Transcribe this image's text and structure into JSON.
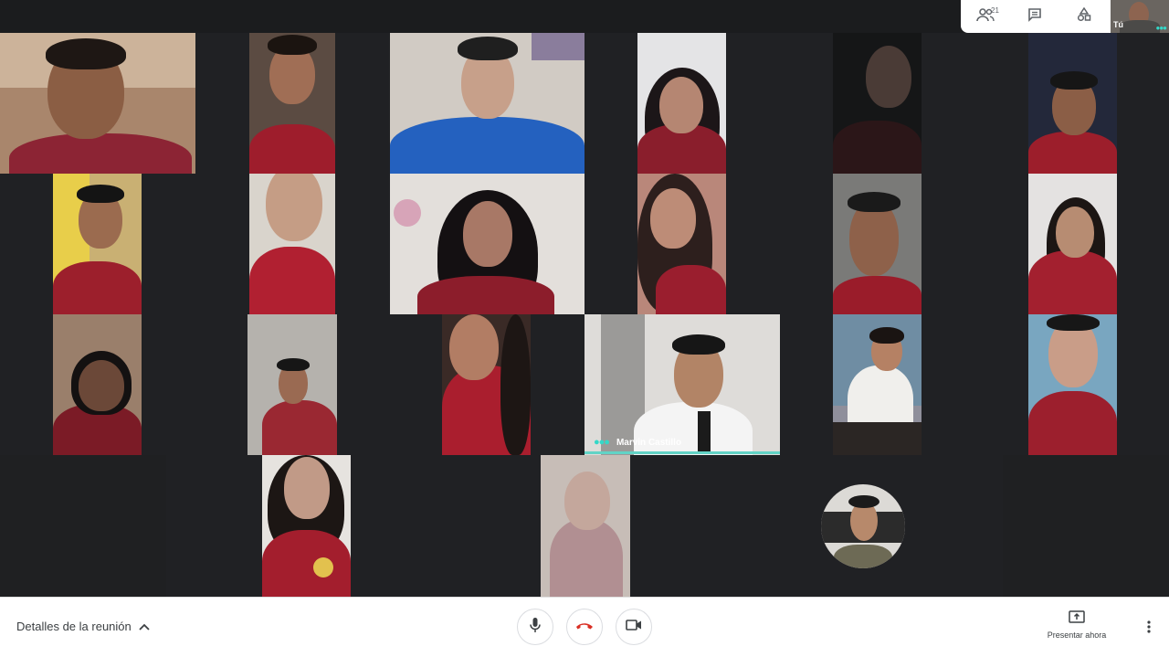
{
  "meeting": {
    "speaker_name": "Marvin Castillo",
    "self_label": "Tú",
    "participants_count": "21"
  },
  "toolbar": {
    "details_label": "Detalles de la reunión",
    "present_label": "Presentar ahora"
  },
  "icons": {
    "participants": "people-icon",
    "chat": "chat-icon",
    "activities": "shapes-icon",
    "mic": "microphone-icon",
    "hangup": "phone-hangup-icon",
    "camera": "videocam-icon",
    "present": "present-screen-icon",
    "more": "more-vert-icon",
    "expand": "chevron-up-icon"
  },
  "colors": {
    "background": "#202124",
    "hangup_red": "#d93025",
    "active_speaker": "#62d3c6",
    "bar": "#ffffff"
  }
}
